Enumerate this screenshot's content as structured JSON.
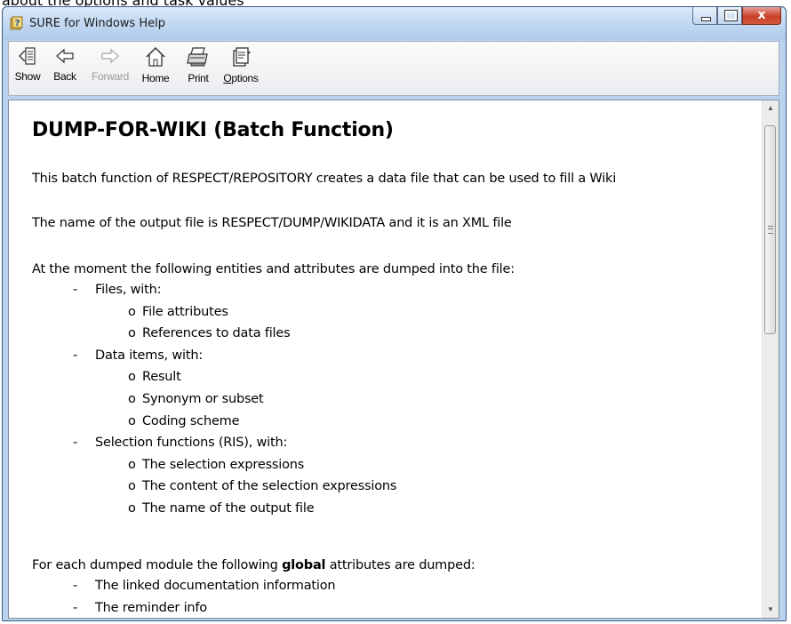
{
  "caption": "about the options and task values",
  "window": {
    "title": "SURE for Windows Help",
    "controls": {
      "minimize": "–",
      "maximize": "□",
      "close": "x"
    }
  },
  "toolbar": {
    "buttons": [
      {
        "label": "Show",
        "icon": "show-pane-icon",
        "enabled": true
      },
      {
        "label": "Back",
        "icon": "back-arrow-icon",
        "enabled": true
      },
      {
        "label": "Forward",
        "icon": "forward-arrow-icon",
        "enabled": false
      },
      {
        "label": "Home",
        "icon": "home-icon",
        "enabled": true
      },
      {
        "label": "Print",
        "icon": "printer-icon",
        "enabled": true
      },
      {
        "label": "Options",
        "icon": "options-icon",
        "enabled": true
      }
    ]
  },
  "document": {
    "heading": "DUMP-FOR-WIKI (Batch Function)",
    "para1": "This batch function of RESPECT/REPOSITORY creates a data file that can be used to fill a Wiki",
    "para2": "The name of the output file is RESPECT/DUMP/WIKIDATA and it is an XML file",
    "para3": "At the moment the following entities and attributes are dumped into the file:",
    "entities": [
      {
        "label": "Files, with:",
        "items": [
          "File attributes",
          "References to data files"
        ]
      },
      {
        "label": "Data items, with:",
        "items": [
          "Result",
          "Synonym or subset",
          "Coding scheme"
        ]
      },
      {
        "label": "Selection functions (RIS), with:",
        "items": [
          "The selection expressions",
          "The content of the selection expressions",
          "The name of the output file"
        ]
      }
    ],
    "para4_before": "For each dumped module the following ",
    "para4_bold": "global",
    "para4_after": " attributes are dumped:",
    "global_attributes": [
      "The linked documentation information",
      "The reminder info"
    ],
    "dash": "-",
    "bullet": "o"
  },
  "colors": {
    "title_bar": "#c4d9f2",
    "close_button": "#c7402a",
    "content_bg": "#ffffff"
  }
}
